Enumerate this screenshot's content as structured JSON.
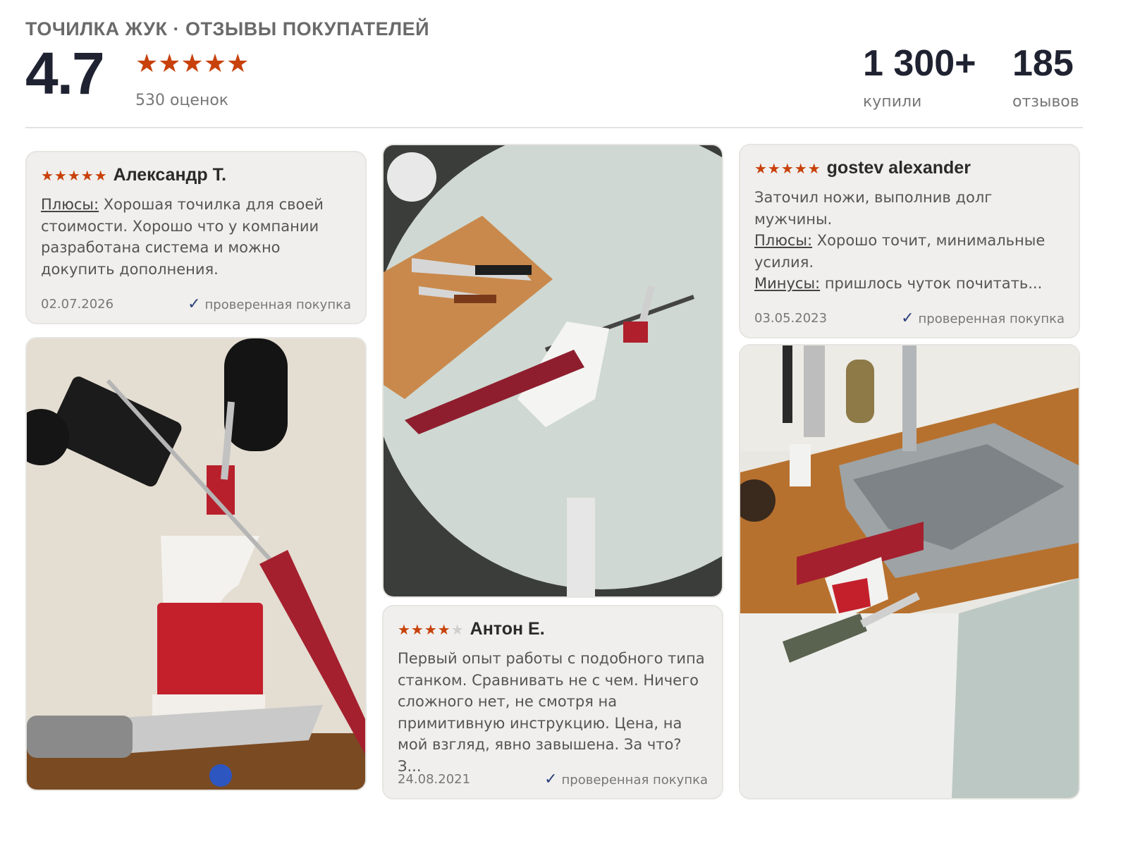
{
  "header": {
    "title": "ТОЧИЛКА ЖУК · ОТЗЫВЫ ПОКУПАТЕЛЕЙ",
    "rating": "4.7",
    "stars": "★★★★★",
    "rating_count": "530 оценок",
    "bought_value": "1 300+",
    "bought_label": "купили",
    "reviews_value": "185",
    "reviews_label": "отзывов"
  },
  "reviews": [
    {
      "stars": "★★★★★",
      "stars_off": "",
      "author": "Александр Т.",
      "pros_label": "Плюсы:",
      "pros_text": " Хорошая точилка для своей стоимости. Хорошо что у компании разработана система и можно докупить дополнения.",
      "date": "02.07.2026",
      "verified": "проверенная покупка"
    },
    {
      "stars": "★★★★",
      "stars_off": "★",
      "author": "Антон Е.",
      "text": "Первый опыт работы с подобного типа станком. Сравнивать не с чем. Ничего сложного нет, не смотря на примитивную инструкцию. Цена, на мой взгляд, явно завышена. За что? З...",
      "date": "24.08.2021",
      "verified": "проверенная покупка"
    },
    {
      "stars": "★★★★★",
      "stars_off": "",
      "author": "gostev alexander",
      "intro": "Заточил ножи, выполнив долг мужчины.",
      "pros_label": "Плюсы:",
      "pros_text": " Хорошо точит, минимальные усилия.",
      "cons_label": "Минусы:",
      "cons_text": " пришлось чуток почитать...",
      "date": "03.05.2023",
      "verified": "проверенная покупка"
    }
  ],
  "icons": {
    "check": "✓"
  },
  "colors": {
    "star": "#c8410b",
    "check": "#2b3f7a",
    "card_bg": "#f0efed",
    "sharpener_red": "#a5202e"
  }
}
